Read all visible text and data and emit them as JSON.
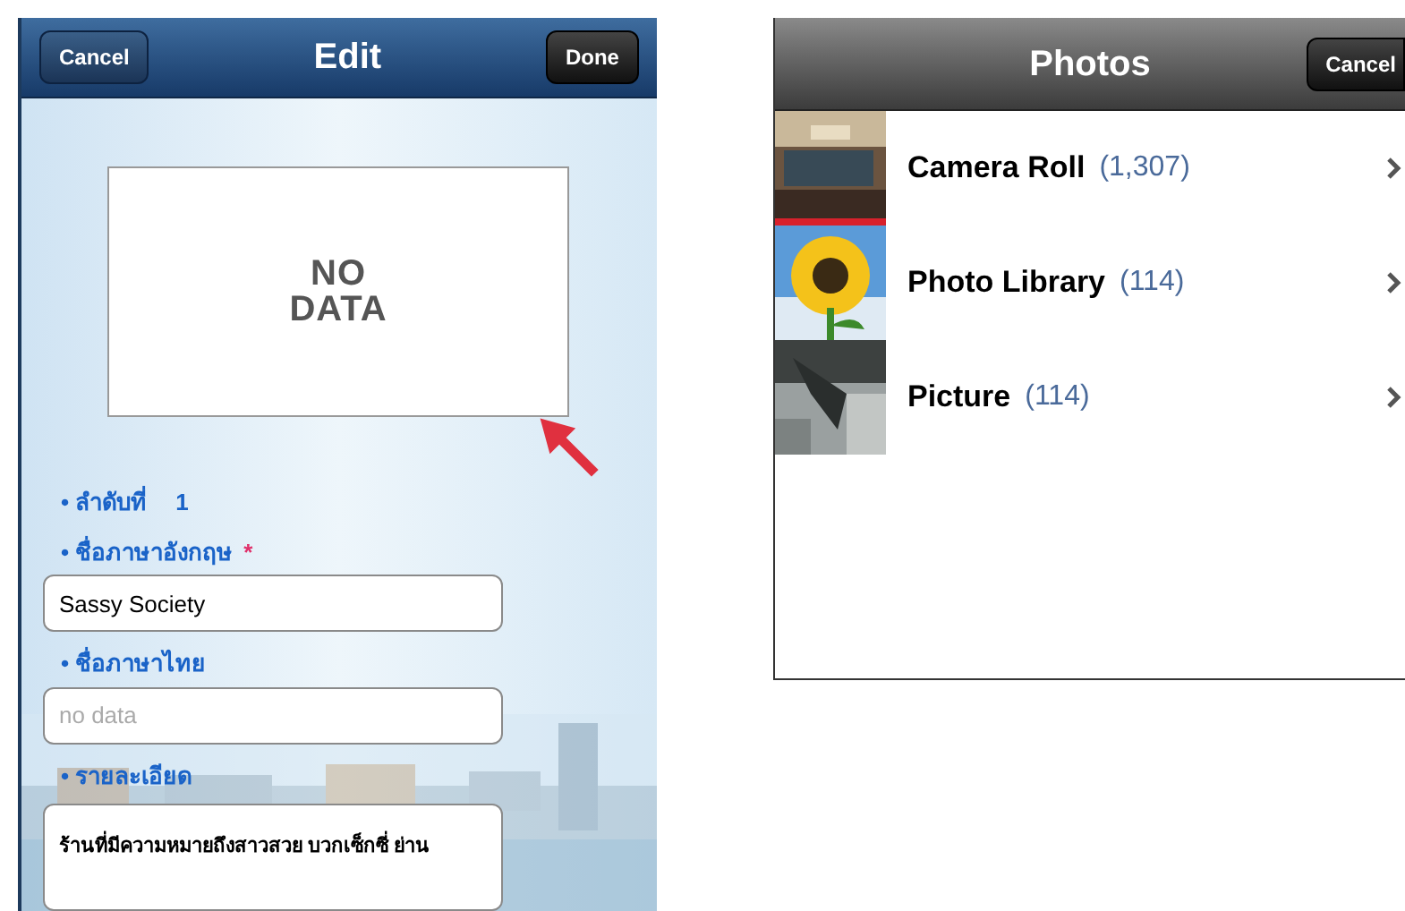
{
  "edit_screen": {
    "nav_bar": {
      "left_button": "Cancel",
      "title": "Edit",
      "right_button": "Done"
    },
    "image_placeholder": [
      "NO",
      "DATA"
    ],
    "fields": [
      {
        "kind": "value",
        "label": "• ลำดับที่",
        "value": "1"
      },
      {
        "kind": "input",
        "label": "• ชื่อภาษาอังกฤษ",
        "required_mark": "*",
        "value": "Sassy Society"
      },
      {
        "kind": "input",
        "label": "• ชื่อภาษาไทย",
        "placeholder": "no data"
      },
      {
        "kind": "textarea",
        "label": "• รายละเอียด",
        "value": "ร้านที่มีความหมายถึงสาวสวย บวกเซ็กซี่ ย่าน"
      }
    ]
  },
  "photos_screen": {
    "nav_bar": {
      "title": "Photos",
      "right_button": "Cancel"
    },
    "albums": [
      {
        "name": "Camera Roll",
        "count": "(1,307)"
      },
      {
        "name": "Photo Library",
        "count": "(114)"
      },
      {
        "name": "Picture",
        "count": "(114)"
      }
    ]
  }
}
